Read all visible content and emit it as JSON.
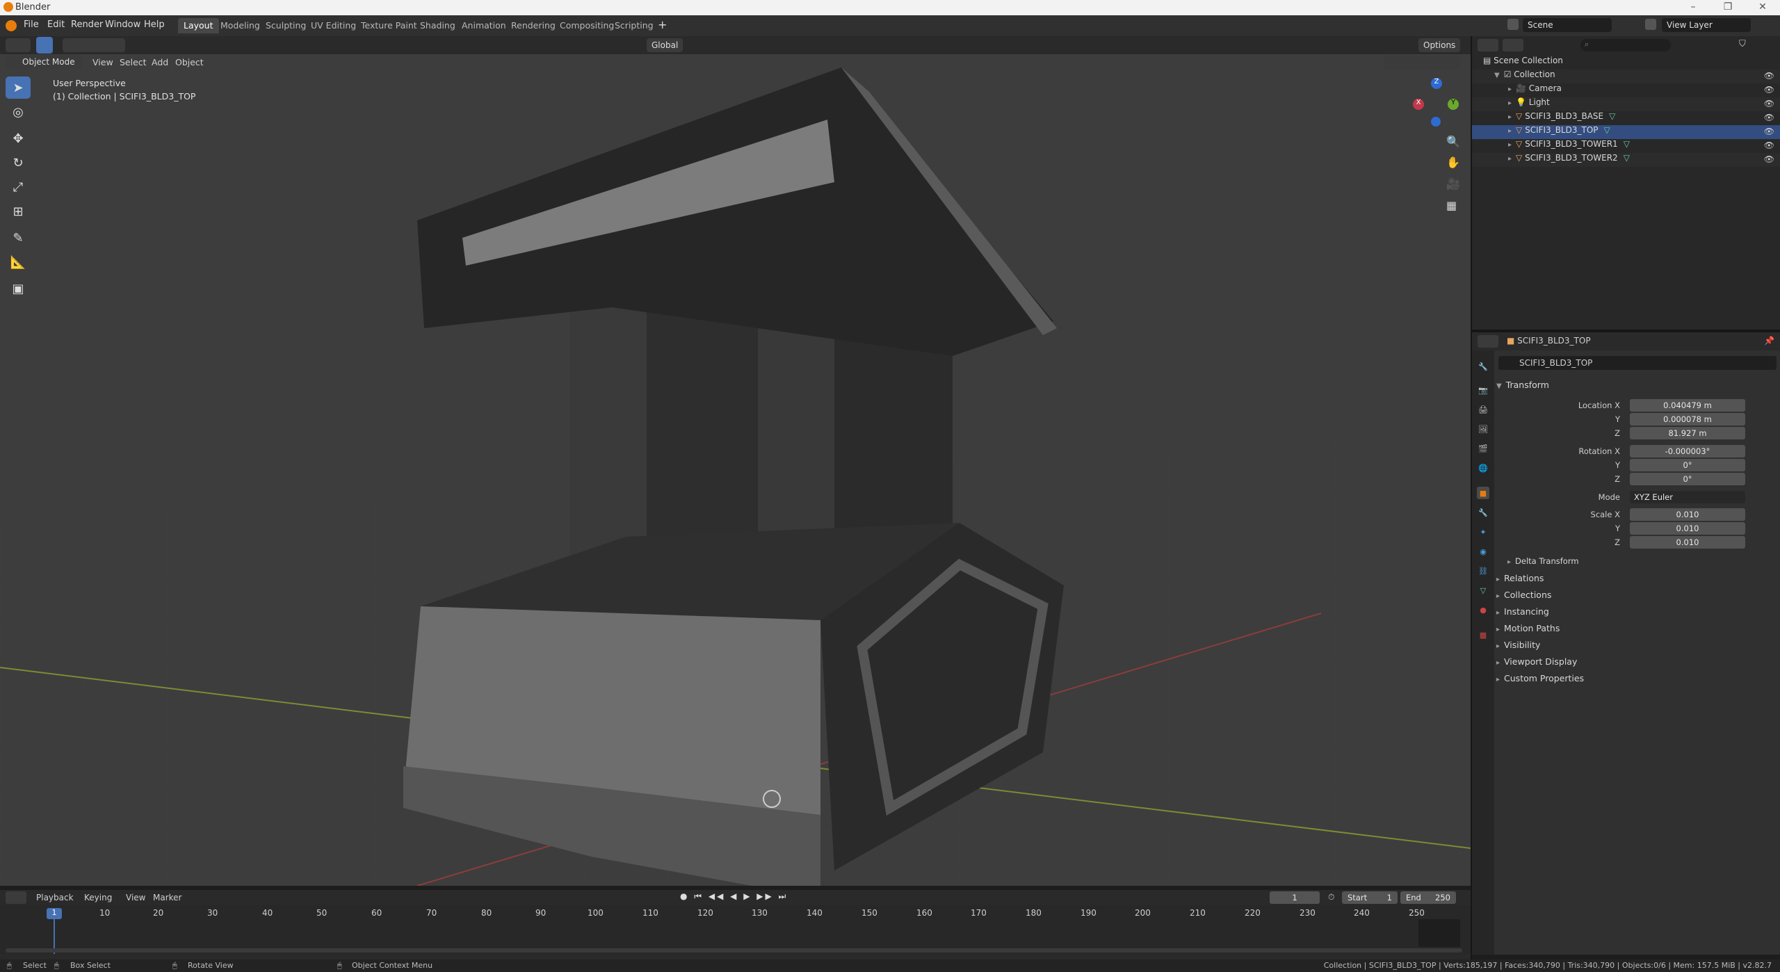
{
  "window": {
    "title": "Blender"
  },
  "menu": [
    "File",
    "Edit",
    "Render",
    "Window",
    "Help"
  ],
  "workspaces": [
    "Layout",
    "Modeling",
    "Sculpting",
    "UV Editing",
    "Texture Paint",
    "Shading",
    "Animation",
    "Rendering",
    "Compositing",
    "Scripting"
  ],
  "scene": {
    "name": "Scene",
    "view_layer": "View Layer"
  },
  "viewport": {
    "mode": "Object Mode",
    "menus": [
      "View",
      "Select",
      "Add",
      "Object"
    ],
    "orientation": "Global",
    "options_label": "Options",
    "overlay_line1": "User Perspective",
    "overlay_line2": "(1) Collection | SCIFI3_BLD3_TOP",
    "gizmo_axes": [
      "X",
      "Y",
      "Z"
    ]
  },
  "outliner": {
    "root": "Scene Collection",
    "collection": "Collection",
    "items": [
      "Camera",
      "Light",
      "SCIFI3_BLD3_BASE",
      "SCIFI3_BLD3_TOP",
      "SCIFI3_BLD3_TOWER1",
      "SCIFI3_BLD3_TOWER2"
    ]
  },
  "properties": {
    "object_name": "SCIFI3_BLD3_TOP",
    "data_name": "SCIFI3_BLD3_TOP",
    "transform": {
      "title": "Transform",
      "location_label": "Location X",
      "loc_x": "0.040479 m",
      "loc_y": "0.000078 m",
      "loc_z": "81.927 m",
      "rotation_label": "Rotation X",
      "rot_x": "-0.000003°",
      "rot_y": "0°",
      "rot_z": "0°",
      "mode_label": "Mode",
      "mode": "XYZ Euler",
      "scale_label": "Scale X",
      "scale_x": "0.010",
      "scale_y": "0.010",
      "scale_z": "0.010",
      "y_label": "Y",
      "z_label": "Z",
      "delta": "Delta Transform"
    },
    "panels": [
      "Relations",
      "Collections",
      "Instancing",
      "Motion Paths",
      "Visibility",
      "Viewport Display",
      "Custom Properties"
    ]
  },
  "timeline": {
    "menus": [
      "Playback",
      "Keying",
      "View",
      "Marker"
    ],
    "current_frame": "1",
    "start_label": "Start",
    "start": "1",
    "end_label": "End",
    "end": "250",
    "ticks": [
      "1",
      "10",
      "20",
      "30",
      "40",
      "50",
      "60",
      "70",
      "80",
      "90",
      "100",
      "110",
      "120",
      "130",
      "140",
      "150",
      "160",
      "170",
      "180",
      "190",
      "200",
      "210",
      "220",
      "230",
      "240",
      "250"
    ]
  },
  "status": {
    "select": "Select",
    "box_select": "Box Select",
    "rotate": "Rotate View",
    "context": "Object Context Menu",
    "info": "Collection | SCIFI3_BLD3_TOP | Verts:185,197 | Faces:340,790 | Tris:340,790 | Objects:0/6 | Mem: 157.5 MiB | v2.82.7"
  },
  "colors": {
    "accent": "#4772b3",
    "bg": "#3c3c3c",
    "orange": "#e87d0d"
  }
}
